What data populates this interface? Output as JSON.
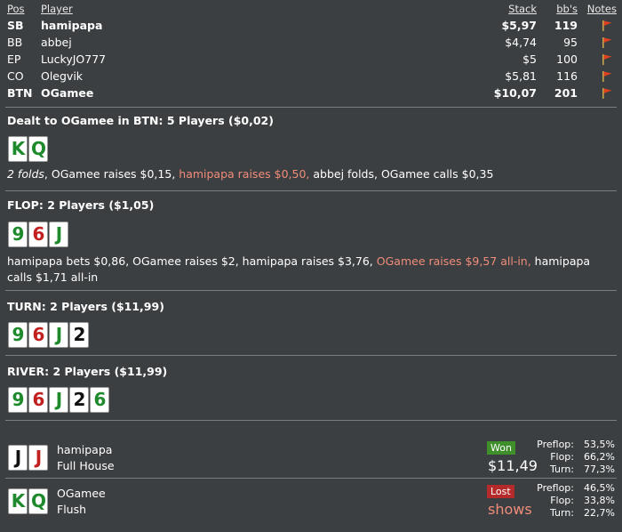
{
  "columns": {
    "pos": "Pos",
    "player": "Player",
    "stack": "Stack",
    "bbs": "bb's",
    "notes": "Notes"
  },
  "players": [
    {
      "pos": "SB",
      "name": "hamipapa",
      "stack": "$5,97",
      "bbs": "119",
      "bold": true
    },
    {
      "pos": "BB",
      "name": "abbej",
      "stack": "$4,74",
      "bbs": "95",
      "bold": false
    },
    {
      "pos": "EP",
      "name": "LuckyJO777",
      "stack": "$5",
      "bbs": "100",
      "bold": false
    },
    {
      "pos": "CO",
      "name": "Olegvik",
      "stack": "$5,81",
      "bbs": "116",
      "bold": false
    },
    {
      "pos": "BTN",
      "name": "OGamee",
      "stack": "$10,07",
      "bbs": "201",
      "bold": true
    }
  ],
  "colors": {
    "background": "#3c3f41",
    "highlight": "#f08c7a",
    "won": "#3f8f2b",
    "lost": "#b52a2a",
    "club": "#1e8a2c",
    "heart": "#c21f1f",
    "spade": "#111111",
    "flag": "#e04020"
  },
  "preflop": {
    "title": "Dealt to OGamee in BTN: 5 Players ($0,02)",
    "cards": [
      {
        "rank": "K",
        "suit": "c"
      },
      {
        "rank": "Q",
        "suit": "c"
      }
    ],
    "actions": [
      {
        "text": "2 folds",
        "style": "it"
      },
      {
        "text": ", OGamee raises $0,15, ",
        "style": ""
      },
      {
        "text": "hamipapa raises $0,50,",
        "style": "hl"
      },
      {
        "text": " abbej folds, OGamee calls $0,35",
        "style": ""
      }
    ]
  },
  "flop": {
    "title": "FLOP: 2 Players ($1,05)",
    "cards": [
      {
        "rank": "9",
        "suit": "c"
      },
      {
        "rank": "6",
        "suit": "h"
      },
      {
        "rank": "J",
        "suit": "c"
      }
    ],
    "actions": [
      {
        "text": "hamipapa bets $0,86, OGamee raises $2, hamipapa raises $3,76, ",
        "style": ""
      },
      {
        "text": "OGamee raises $9,57 all-in,",
        "style": "hl"
      },
      {
        "text": " hamipapa calls $1,71 all-in",
        "style": ""
      }
    ]
  },
  "turn": {
    "title": "TURN: 2 Players ($11,99)",
    "cards": [
      {
        "rank": "9",
        "suit": "c"
      },
      {
        "rank": "6",
        "suit": "h"
      },
      {
        "rank": "J",
        "suit": "c"
      },
      {
        "rank": "2",
        "suit": "s"
      }
    ]
  },
  "river": {
    "title": "RIVER: 2 Players ($11,99)",
    "cards": [
      {
        "rank": "9",
        "suit": "c"
      },
      {
        "rank": "6",
        "suit": "h"
      },
      {
        "rank": "J",
        "suit": "c"
      },
      {
        "rank": "2",
        "suit": "s"
      },
      {
        "rank": "6",
        "suit": "c"
      }
    ]
  },
  "results": [
    {
      "name": "hamipapa",
      "hand": "Full House",
      "cards": [
        {
          "rank": "J",
          "suit": "s"
        },
        {
          "rank": "J",
          "suit": "h"
        }
      ],
      "status": "Won",
      "amount": "$11,49",
      "equity": [
        {
          "label": "Preflop:",
          "value": "53,5%"
        },
        {
          "label": "Flop:",
          "value": "66,2%"
        },
        {
          "label": "Turn:",
          "value": "77,3%"
        }
      ]
    },
    {
      "name": "OGamee",
      "hand": "Flush",
      "cards": [
        {
          "rank": "K",
          "suit": "c"
        },
        {
          "rank": "Q",
          "suit": "c"
        }
      ],
      "status": "Lost",
      "amount": "shows",
      "equity": [
        {
          "label": "Preflop:",
          "value": "46,5%"
        },
        {
          "label": "Flop:",
          "value": "33,8%"
        },
        {
          "label": "Turn:",
          "value": "22,7%"
        }
      ]
    }
  ]
}
